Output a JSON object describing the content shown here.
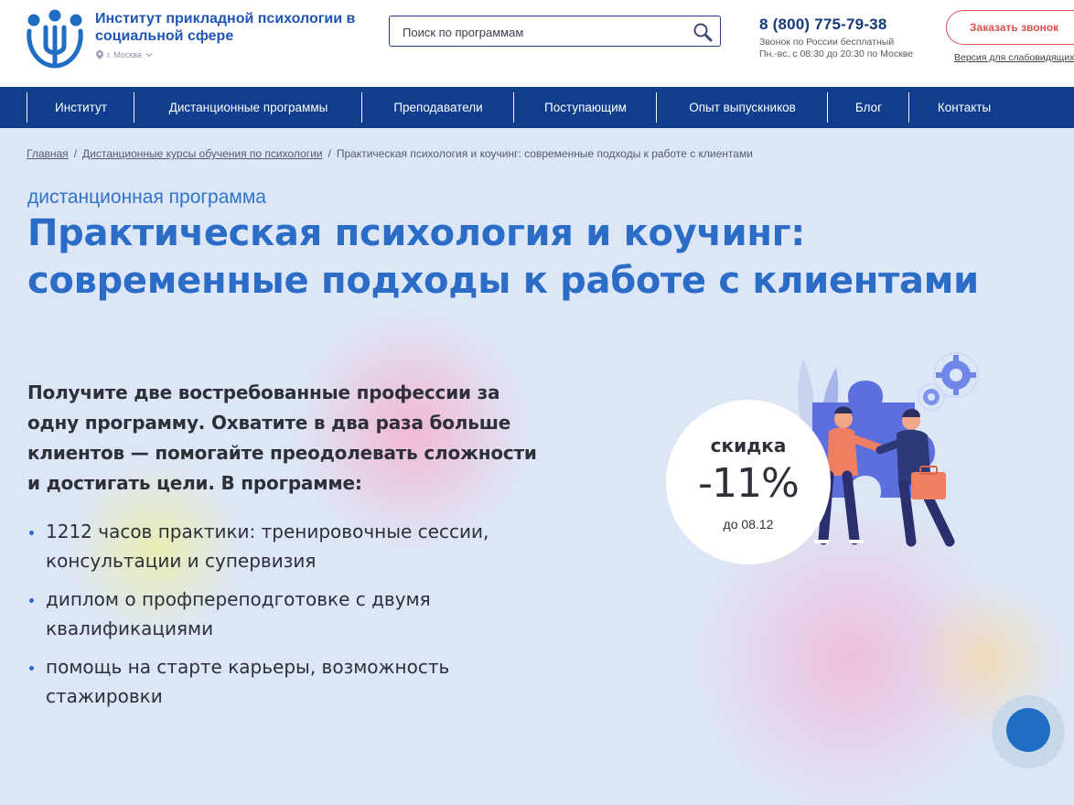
{
  "colors": {
    "brand_blue": "#2b6cc6",
    "nav_bg": "#113d8e",
    "accent_red": "#d9534f",
    "text_dark": "#2d3038"
  },
  "header": {
    "logo_icon": "institute-logo-icon",
    "logo_title": "Институт прикладной психологии в социальной сфере",
    "city": "г. Москва",
    "search_placeholder": "Поиск по программам",
    "phone": "8 (800) 775-79-38",
    "phone_note_1": "Звонок по России бесплатный",
    "phone_note_2": "Пн.-вс. с 08:30 до 20:30 по Москве",
    "callback_label": "Заказать звонок",
    "accessible_label": "Версия для слабовидящих"
  },
  "nav": {
    "items": [
      {
        "label": "Институт"
      },
      {
        "label": "Дистанционные программы"
      },
      {
        "label": "Преподаватели"
      },
      {
        "label": "Поступающим"
      },
      {
        "label": "Опыт выпускников"
      },
      {
        "label": "Блог"
      },
      {
        "label": "Контакты"
      }
    ]
  },
  "breadcrumb": {
    "home": "Главная",
    "section": "Дистанционные курсы обучения по психологии",
    "current": "Практическая психология и коучинг: современные подходы к работе с клиентами"
  },
  "hero": {
    "eyebrow": "дистанционная программа",
    "title": "Практическая психология и коучинг: современные подходы к работе с клиентами",
    "lead": "Получите две востребованные профессии за одну программу. Охватите в два раза больше клиентов — помогайте преодолевать сложности и достигать цели. В программе:",
    "bullets": [
      "1212 часов практики: тренировочные сессии, консультации и супервизия",
      "диплом о профпереподготовке с двумя квалификациями",
      "помощь на старте карьеры, возможность стажировки"
    ],
    "discount": {
      "label": "скидка",
      "value": "-11%",
      "until": "до 08.12"
    }
  }
}
